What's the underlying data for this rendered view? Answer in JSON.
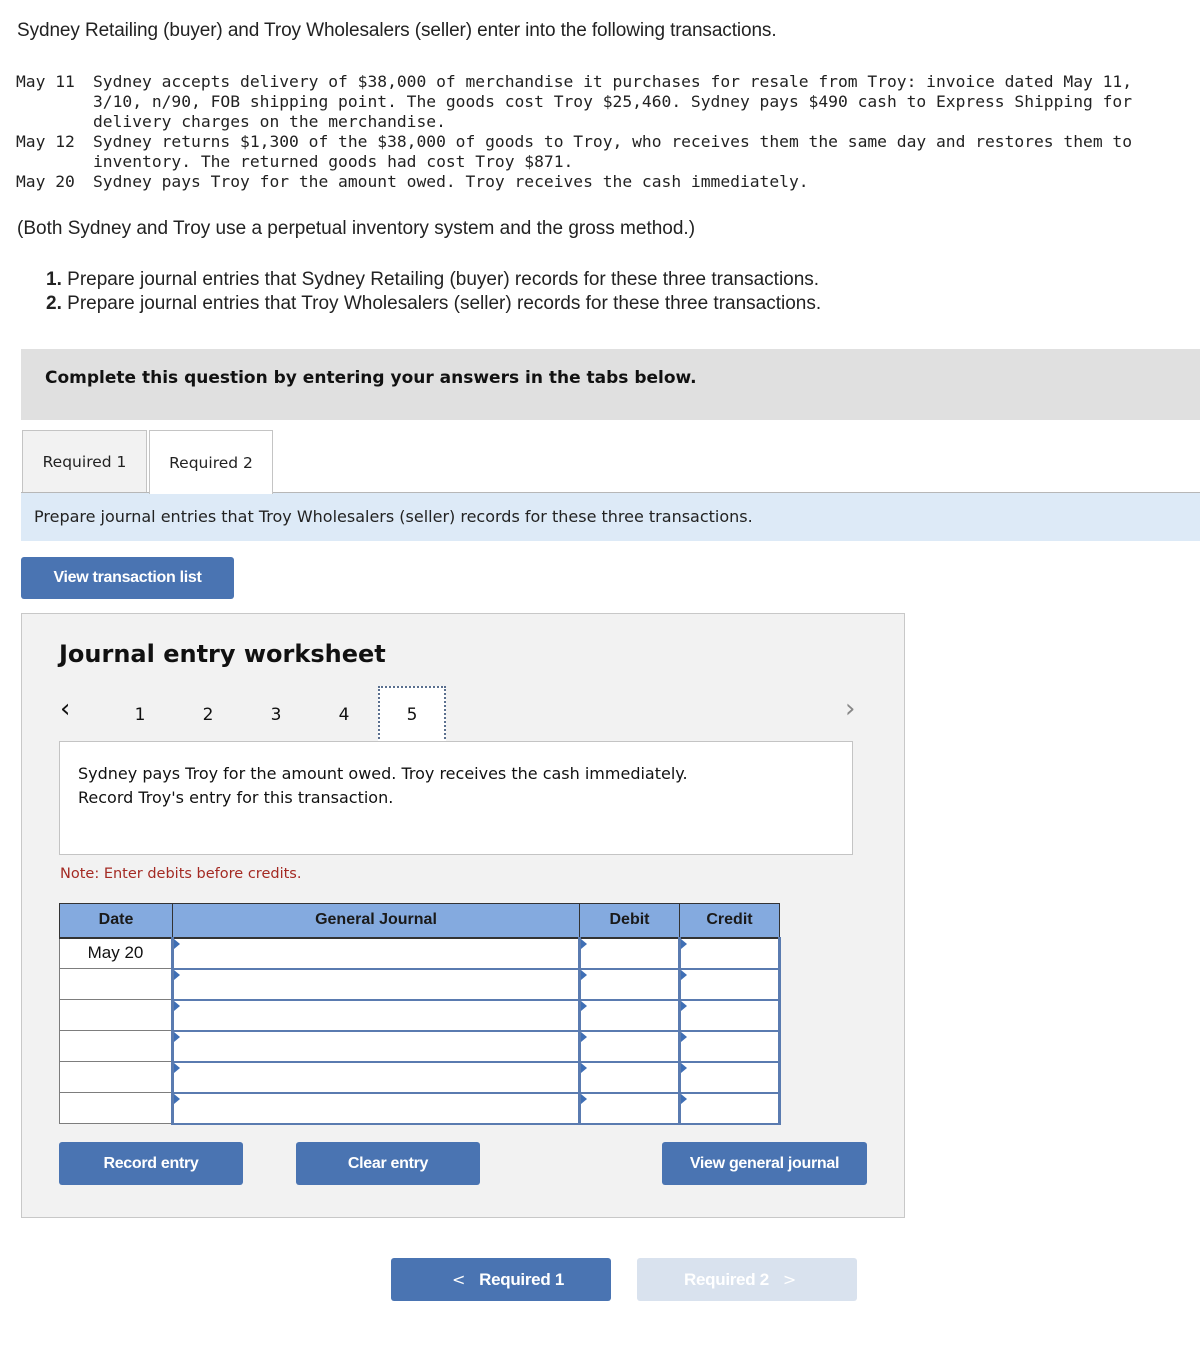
{
  "intro": "Sydney Retailing (buyer) and Troy Wholesalers (seller) enter into the following transactions.",
  "transactions": [
    {
      "date": "May 11",
      "description": "Sydney accepts delivery of $38,000 of merchandise it purchases for resale from Troy: invoice dated May 11,\n3/10, n/90, FOB shipping point. The goods cost Troy $25,460. Sydney pays $490 cash to Express Shipping for\ndelivery charges on the merchandise."
    },
    {
      "date": "May 12",
      "description": "Sydney returns $1,300 of the $38,000 of goods to Troy, who receives them the same day and restores them to\ninventory. The returned goods had cost Troy $871."
    },
    {
      "date": "May 20",
      "description": "Sydney pays Troy for the amount owed. Troy receives the cash immediately."
    }
  ],
  "method_note": "(Both Sydney and Troy use a perpetual inventory system and the gross method.)",
  "requirements": [
    {
      "num": "1.",
      "text": "Prepare journal entries that Sydney Retailing (buyer) records for these three transactions."
    },
    {
      "num": "2.",
      "text": "Prepare journal entries that Troy Wholesalers (seller) records for these three transactions."
    }
  ],
  "banner": "Complete this question by entering your answers in the tabs below.",
  "tabs": [
    {
      "label": "Required 1",
      "active": false
    },
    {
      "label": "Required 2",
      "active": true
    }
  ],
  "instruction": "Prepare journal entries that Troy Wholesalers (seller) records for these three transactions.",
  "view_transaction_list": "View transaction list",
  "worksheet": {
    "title": "Journal entry worksheet",
    "pages": [
      "1",
      "2",
      "3",
      "4",
      "5"
    ],
    "active_page": "5",
    "prev_icon": "‹",
    "next_icon": "›",
    "description": "Sydney pays Troy for the amount owed. Troy receives the cash immediately.\nRecord Troy's entry for this transaction.",
    "note": "Note: Enter debits before credits.",
    "columns": {
      "date": "Date",
      "general_journal": "General Journal",
      "debit": "Debit",
      "credit": "Credit"
    },
    "rows": [
      {
        "date": "May 20",
        "account": "",
        "debit": "",
        "credit": ""
      },
      {
        "date": "",
        "account": "",
        "debit": "",
        "credit": ""
      },
      {
        "date": "",
        "account": "",
        "debit": "",
        "credit": ""
      },
      {
        "date": "",
        "account": "",
        "debit": "",
        "credit": ""
      },
      {
        "date": "",
        "account": "",
        "debit": "",
        "credit": ""
      },
      {
        "date": "",
        "account": "",
        "debit": "",
        "credit": ""
      }
    ],
    "buttons": {
      "record": "Record entry",
      "clear": "Clear entry",
      "view_general_journal": "View general journal"
    }
  },
  "navigation": {
    "prev_label": "Required 1",
    "next_label": "Required 2",
    "prev_icon": "<",
    "next_icon": ">",
    "next_disabled": true
  },
  "colors": {
    "accent_button": "#4a74b2",
    "table_header": "#84aadf",
    "note_text": "#a42a23",
    "instruction_bg": "#ddeaf7",
    "disabled_button": "#d9e2ee"
  }
}
